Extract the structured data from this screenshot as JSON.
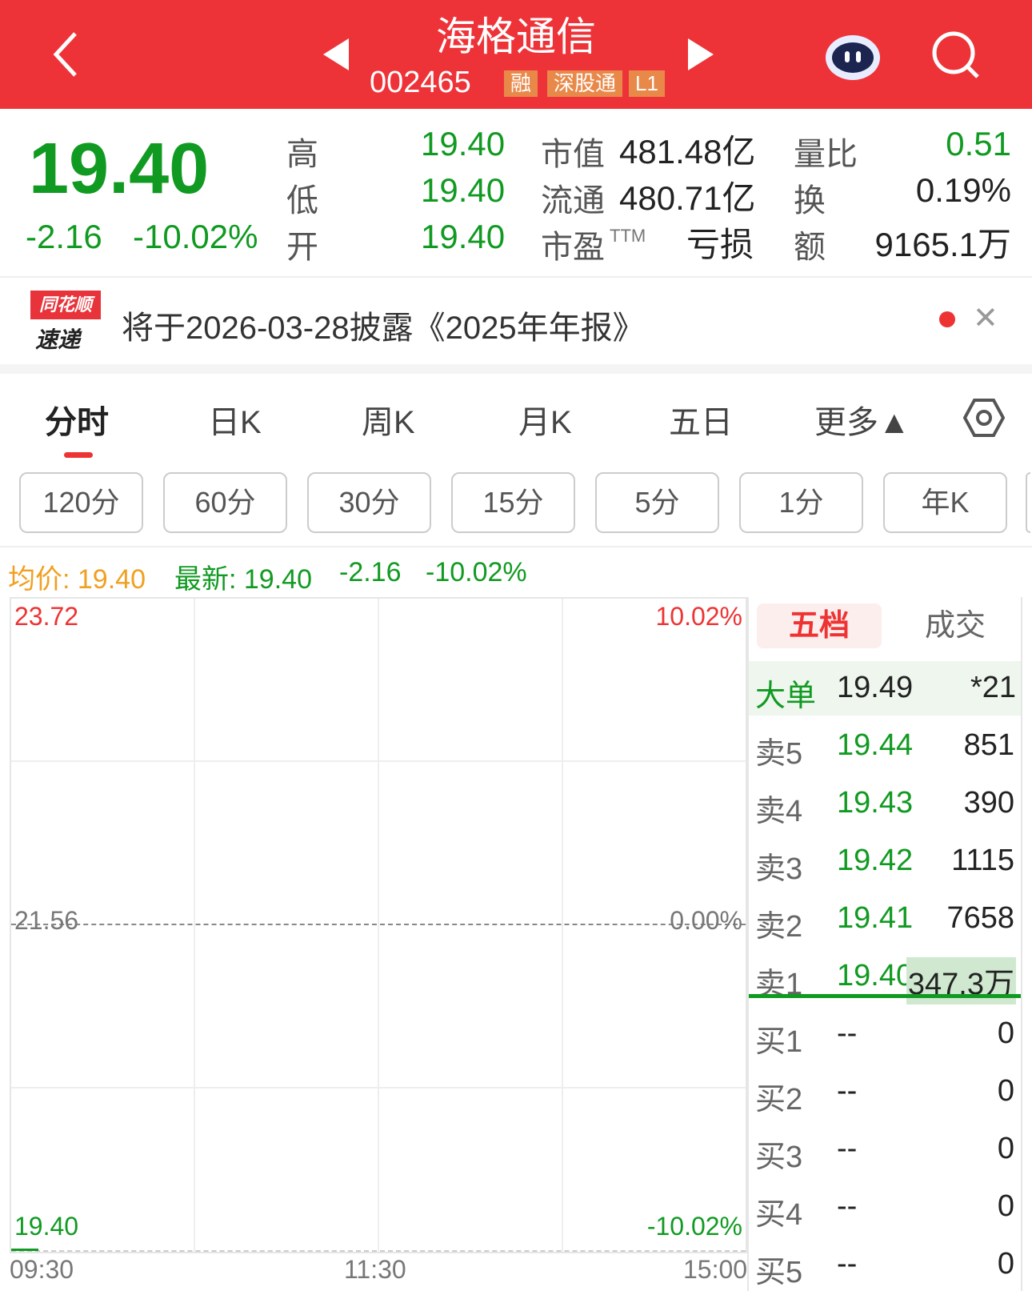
{
  "header": {
    "name": "海格通信",
    "code": "002465",
    "tags": [
      "融",
      "深股通",
      "L1"
    ]
  },
  "quote": {
    "price": "19.40",
    "change": "-2.16",
    "change_pct": "-10.02%",
    "stats": [
      {
        "label": "高",
        "value": "19.40"
      },
      {
        "label": "低",
        "value": "19.40"
      },
      {
        "label": "开",
        "value": "19.40"
      },
      {
        "label": "市值",
        "value": "481.48亿"
      },
      {
        "label": "流通",
        "value": "480.71亿"
      },
      {
        "label": "市盈",
        "sup": "TTM",
        "value": "亏损"
      },
      {
        "label": "量比",
        "value": "0.51"
      },
      {
        "label": "换",
        "value": "0.19%"
      },
      {
        "label": "额",
        "value": "9165.1万"
      }
    ]
  },
  "notice": {
    "logo_top": "同花顺",
    "logo_bottom": "速递",
    "text": "将于2026-03-28披露《2025年年报》"
  },
  "tabs": [
    "分时",
    "日K",
    "周K",
    "月K",
    "五日",
    "更多▲"
  ],
  "periods": [
    "120分",
    "60分",
    "30分",
    "15分",
    "5分",
    "1分",
    "年K"
  ],
  "info": {
    "avg": "均价: 19.40",
    "last": "最新: 19.40",
    "chg": "-2.16",
    "pct": "-10.02%"
  },
  "chart": {
    "y_top": "23.72",
    "y_mid": "21.56",
    "y_bot": "19.40",
    "p_top": "10.02%",
    "p_mid": "0.00%",
    "p_bot": "-10.02%",
    "times": [
      "09:30",
      "11:30",
      "15:00"
    ]
  },
  "book": {
    "tabs": [
      "五档",
      "成交"
    ],
    "big": {
      "label": "大单",
      "price": "19.49",
      "vol": "*21"
    },
    "asks": [
      {
        "l": "卖5",
        "p": "19.44",
        "v": "851"
      },
      {
        "l": "卖4",
        "p": "19.43",
        "v": "390"
      },
      {
        "l": "卖3",
        "p": "19.42",
        "v": "1115"
      },
      {
        "l": "卖2",
        "p": "19.41",
        "v": "7658"
      },
      {
        "l": "卖1",
        "p": "19.40",
        "v": "347.3万"
      }
    ],
    "bids": [
      {
        "l": "买1",
        "p": "--",
        "v": "0"
      },
      {
        "l": "买2",
        "p": "--",
        "v": "0"
      },
      {
        "l": "买3",
        "p": "--",
        "v": "0"
      },
      {
        "l": "买4",
        "p": "--",
        "v": "0"
      },
      {
        "l": "买5",
        "p": "--",
        "v": "0"
      }
    ]
  }
}
